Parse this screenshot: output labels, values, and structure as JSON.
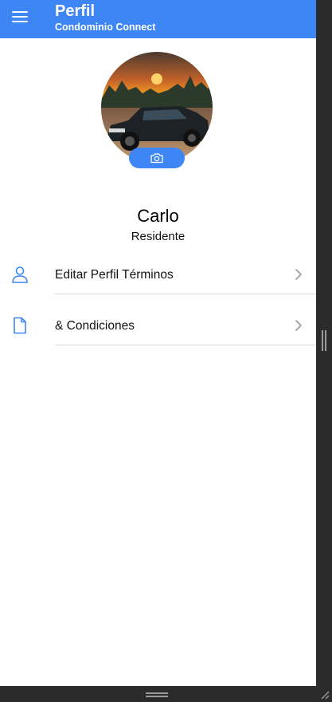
{
  "header": {
    "title": "Perfil",
    "subtitle": "Condominio Connect",
    "menu_icon": "hamburger-menu-icon"
  },
  "profile": {
    "name": "Carlo",
    "role": "Residente",
    "avatar": "car-sunset-photo",
    "camera_icon": "camera-icon"
  },
  "menu": {
    "items": [
      {
        "label": "Editar Perfil Términos",
        "icon": "user-icon"
      },
      {
        "label": "& Condiciones",
        "icon": "document-icon"
      }
    ]
  },
  "colors": {
    "primary": "#3e86f5",
    "background": "#ffffff",
    "divider": "#d8d8d8",
    "chrome": "#2b2b2b"
  }
}
